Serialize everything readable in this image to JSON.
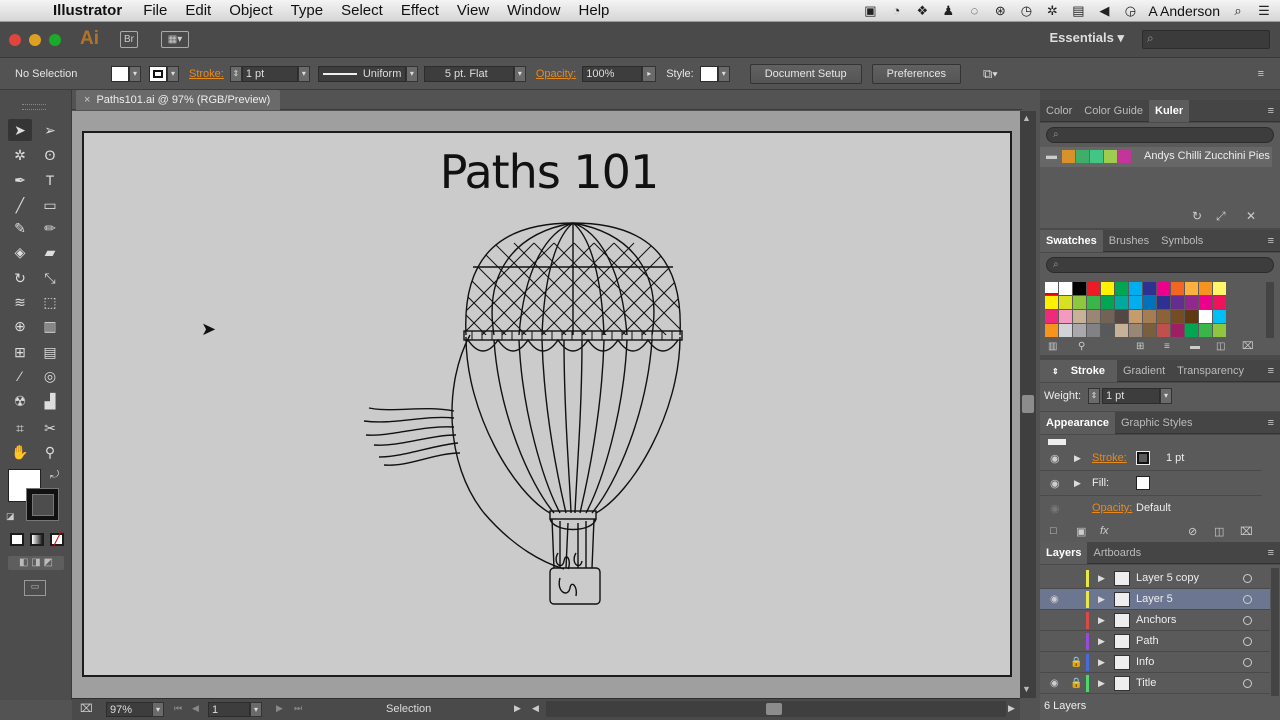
{
  "menubar": {
    "app_name": "Illustrator",
    "items": [
      "File",
      "Edit",
      "Object",
      "Type",
      "Select",
      "Effect",
      "View",
      "Window",
      "Help"
    ],
    "user": "A Anderson"
  },
  "appbar": {
    "logo": "Ai",
    "bridge": "Br",
    "workspace": "Essentials",
    "workspace_caret": "▾"
  },
  "control": {
    "selection": "No Selection",
    "stroke_label": "Stroke:",
    "stroke_weight": "1 pt",
    "profile": "Uniform",
    "brush": "5 pt. Flat",
    "opacity_label": "Opacity:",
    "opacity": "100%",
    "style_label": "Style:",
    "document_setup": "Document Setup",
    "preferences": "Preferences"
  },
  "document": {
    "tab_title": "Paths101.ai @ 97% (RGB/Preview)",
    "close_glyph": "×",
    "artboard_title": "Paths 101"
  },
  "status": {
    "zoom": "97%",
    "artboard_num": "1",
    "tool": "Selection"
  },
  "panels": {
    "color_tabs": [
      "Color",
      "Color Guide",
      "Kuler"
    ],
    "kuler_theme": "Andys   Chilli Zucchini Pies",
    "swatch_tabs": [
      "Swatches",
      "Brushes",
      "Symbols"
    ],
    "stroke_tabs": [
      "Stroke",
      "Gradient",
      "Transparency"
    ],
    "weight_label": "Weight:",
    "weight_value": "1 pt",
    "appearance_tabs": [
      "Appearance",
      "Graphic Styles"
    ],
    "appearance": {
      "stroke_label": "Stroke:",
      "stroke_value": "1 pt",
      "fill_label": "Fill:",
      "opacity_label": "Opacity:",
      "opacity_value": "Default"
    },
    "layers_tabs": [
      "Layers",
      "Artboards"
    ],
    "layers": [
      {
        "name": "Layer 5 copy",
        "color": "#e8e84a",
        "visible": false,
        "locked": false,
        "selected": false
      },
      {
        "name": "Layer 5",
        "color": "#e8e84a",
        "visible": true,
        "locked": false,
        "selected": true
      },
      {
        "name": "Anchors",
        "color": "#d94a4a",
        "visible": false,
        "locked": false,
        "selected": false
      },
      {
        "name": "Path",
        "color": "#9a4ad9",
        "visible": false,
        "locked": false,
        "selected": false
      },
      {
        "name": "Info",
        "color": "#4a6ad9",
        "visible": false,
        "locked": true,
        "selected": false
      },
      {
        "name": "Title",
        "color": "#4ad96a",
        "visible": true,
        "locked": true,
        "selected": false
      }
    ],
    "layers_count": "6 Layers"
  },
  "colors": {
    "accent_orange": "#e8891b",
    "panel_bg": "#5a5a5a",
    "artboard": "#cbcbcb"
  }
}
